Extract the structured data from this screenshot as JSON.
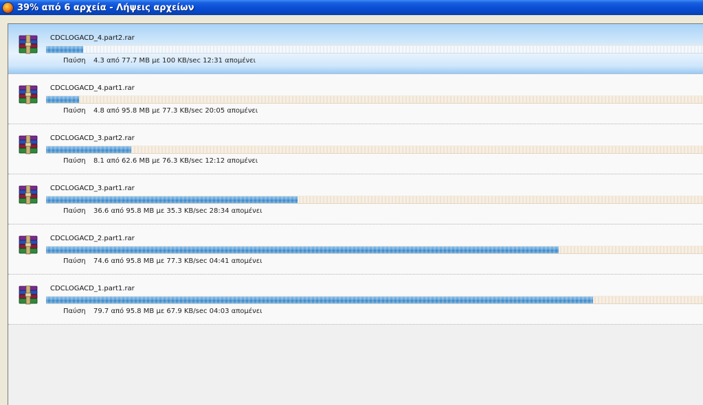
{
  "window": {
    "title": "39% από 6 αρχεία - Λήψεις αρχείων",
    "icon": "firefox-icon"
  },
  "downloads": [
    {
      "filename": "CDCLOGACD_4.part2.rar",
      "status_label": "Παύση",
      "status": "4.3 από 77.7 MB με 100 KB/sec 12:31 απομένει",
      "progress": 0.056,
      "selected": true,
      "icon": "winrar-archive-icon"
    },
    {
      "filename": "CDCLOGACD_4.part1.rar",
      "status_label": "Παύση",
      "status": "4.8 από 95.8 MB με 77.3 KB/sec 20:05 απομένει",
      "progress": 0.05,
      "selected": false,
      "icon": "winrar-archive-icon"
    },
    {
      "filename": "CDCLOGACD_3.part2.rar",
      "status_label": "Παύση",
      "status": "8.1 από 62.6 MB με 76.3 KB/sec 12:12 απομένει",
      "progress": 0.13,
      "selected": false,
      "icon": "winrar-archive-icon"
    },
    {
      "filename": "CDCLOGACD_3.part1.rar",
      "status_label": "Παύση",
      "status": "36.6 από 95.8 MB με 35.3 KB/sec 28:34 απομένει",
      "progress": 0.382,
      "selected": false,
      "icon": "winrar-archive-icon"
    },
    {
      "filename": "CDCLOGACD_2.part1.rar",
      "status_label": "Παύση",
      "status": "74.6 από 95.8 MB με 77.3 KB/sec 04:41 απομένει",
      "progress": 0.779,
      "selected": false,
      "icon": "winrar-archive-icon"
    },
    {
      "filename": "CDCLOGACD_1.part1.rar",
      "status_label": "Παύση",
      "status": "79.7 από 95.8 MB με 67.9 KB/sec 04:03 απομένει",
      "progress": 0.832,
      "selected": false,
      "icon": "winrar-archive-icon"
    }
  ],
  "colors": {
    "titlebar": "#0a4fd6",
    "progress_fill": "#5ea2da",
    "selection": "#cfe6fb"
  }
}
